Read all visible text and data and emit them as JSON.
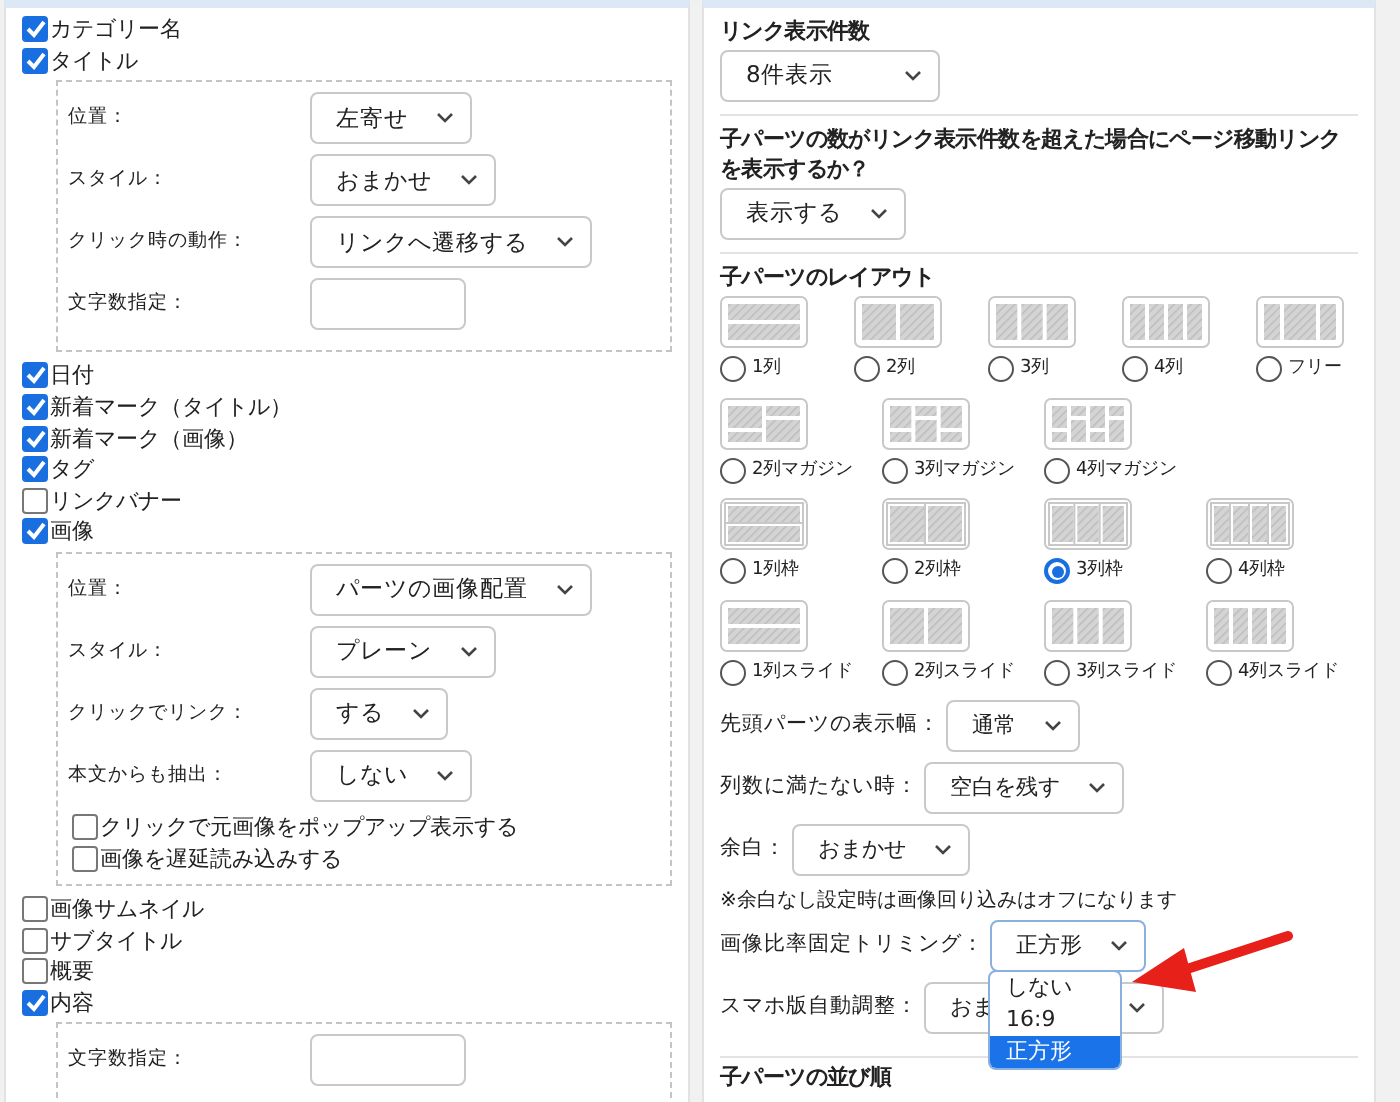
{
  "left": {
    "items": [
      {
        "label": "カテゴリー名",
        "checked": true
      },
      {
        "label": "タイトル",
        "checked": true,
        "settings": [
          {
            "label": "位置：",
            "kind": "select",
            "value": "左寄せ"
          },
          {
            "label": "スタイル：",
            "kind": "select",
            "value": "おまかせ"
          },
          {
            "label": "クリック時の動作：",
            "kind": "select",
            "value": "リンクへ遷移する"
          },
          {
            "label": "文字数指定：",
            "kind": "text"
          }
        ]
      },
      {
        "label": "日付",
        "checked": true
      },
      {
        "label": "新着マーク（タイトル）",
        "checked": true
      },
      {
        "label": "新着マーク（画像）",
        "checked": true
      },
      {
        "label": "タグ",
        "checked": true
      },
      {
        "label": "リンクバナー",
        "checked": false
      },
      {
        "label": "画像",
        "checked": true,
        "settings": [
          {
            "label": "位置：",
            "kind": "select",
            "value": "パーツの画像配置"
          },
          {
            "label": "スタイル：",
            "kind": "select",
            "value": "プレーン"
          },
          {
            "label": "クリックでリンク：",
            "kind": "select",
            "value": "する"
          },
          {
            "label": "本文からも抽出：",
            "kind": "select",
            "value": "しない"
          }
        ],
        "options": [
          {
            "label": "クリックで元画像をポップアップ表示する",
            "checked": false
          },
          {
            "label": "画像を遅延読み込みする",
            "checked": false
          }
        ]
      },
      {
        "label": "画像サムネイル",
        "checked": false
      },
      {
        "label": "サブタイトル",
        "checked": false
      },
      {
        "label": "概要",
        "checked": false
      },
      {
        "label": "内容",
        "checked": true,
        "settings": [
          {
            "label": "文字数指定：",
            "kind": "text"
          }
        ]
      }
    ]
  },
  "right": {
    "sections": [
      {
        "kind": "select",
        "title": "リンク表示件数",
        "value": "8件表示"
      },
      {
        "kind": "select",
        "title": "子パーツの数がリンク表示件数を超えた場合にページ移動リンクを表示するか？",
        "value": "表示する"
      },
      {
        "kind": "layout",
        "title": "子パーツのレイアウト",
        "rows": [
          {
            "options": [
              {
                "label": "1列",
                "kind": "col1",
                "selected": false
              },
              {
                "label": "2列",
                "kind": "col2",
                "selected": false
              },
              {
                "label": "3列",
                "kind": "col3",
                "selected": false
              },
              {
                "label": "4列",
                "kind": "col4",
                "selected": false
              },
              {
                "label": "フリー",
                "kind": "free",
                "selected": false
              }
            ]
          },
          {
            "options": [
              {
                "label": "2列マガジン",
                "kind": "mag2",
                "selected": false
              },
              {
                "label": "3列マガジン",
                "kind": "mag3",
                "selected": false
              },
              {
                "label": "4列マガジン",
                "kind": "mag4",
                "selected": false
              }
            ]
          },
          {
            "options": [
              {
                "label": "1列枠",
                "kind": "frame1",
                "selected": false
              },
              {
                "label": "2列枠",
                "kind": "frame2",
                "selected": false
              },
              {
                "label": "3列枠",
                "kind": "frame3",
                "selected": true
              },
              {
                "label": "4列枠",
                "kind": "frame4",
                "selected": false
              }
            ]
          },
          {
            "options": [
              {
                "label": "1列スライド",
                "kind": "col1",
                "selected": false
              },
              {
                "label": "2列スライド",
                "kind": "col2",
                "selected": false
              },
              {
                "label": "3列スライド",
                "kind": "col3",
                "selected": false
              },
              {
                "label": "4列スライド",
                "kind": "col4",
                "selected": false
              }
            ]
          }
        ],
        "fields": [
          {
            "kind": "select",
            "label": "先頭パーツの表示幅：",
            "value": "通常",
            "expanded": false
          },
          {
            "kind": "select",
            "label": "列数に満たない時：",
            "value": "空白を残す",
            "expanded": false
          },
          {
            "kind": "select",
            "label": "余白：",
            "value": "おまかせ",
            "expanded": false
          },
          {
            "kind": "note",
            "label": "※余白なし設定時は画像回り込みはオフになります"
          },
          {
            "kind": "select",
            "label": "画像比率固定トリミング：",
            "value": "正方形",
            "expanded": true,
            "options": [
              {
                "label": "しない",
                "selected": false
              },
              {
                "label": "16:9",
                "selected": false
              },
              {
                "label": "正方形",
                "selected": true
              }
            ]
          },
          {
            "kind": "select",
            "label": "スマホ版自動調整：",
            "value": "おま",
            "expanded": false
          }
        ]
      },
      {
        "kind": "heading",
        "title": "子パーツの並び順"
      }
    ]
  }
}
